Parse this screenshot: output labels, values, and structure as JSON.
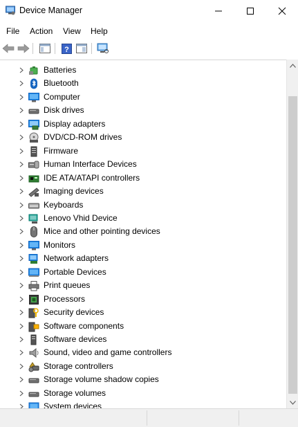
{
  "window": {
    "title": "Device Manager"
  },
  "menu": {
    "items": [
      "File",
      "Action",
      "View",
      "Help"
    ]
  },
  "tree": {
    "items": [
      {
        "label": "Batteries",
        "icon": "battery-icon"
      },
      {
        "label": "Bluetooth",
        "icon": "bluetooth-icon"
      },
      {
        "label": "Computer",
        "icon": "computer-icon"
      },
      {
        "label": "Disk drives",
        "icon": "disk-drive-icon"
      },
      {
        "label": "Display adapters",
        "icon": "display-adapter-icon"
      },
      {
        "label": "DVD/CD-ROM drives",
        "icon": "dvd-drive-icon"
      },
      {
        "label": "Firmware",
        "icon": "firmware-icon"
      },
      {
        "label": "Human Interface Devices",
        "icon": "hid-icon"
      },
      {
        "label": "IDE ATA/ATAPI controllers",
        "icon": "ide-controller-icon"
      },
      {
        "label": "Imaging devices",
        "icon": "imaging-device-icon"
      },
      {
        "label": "Keyboards",
        "icon": "keyboard-icon"
      },
      {
        "label": "Lenovo Vhid Device",
        "icon": "lenovo-device-icon"
      },
      {
        "label": "Mice and other pointing devices",
        "icon": "mouse-icon"
      },
      {
        "label": "Monitors",
        "icon": "monitor-icon"
      },
      {
        "label": "Network adapters",
        "icon": "network-adapter-icon"
      },
      {
        "label": "Portable Devices",
        "icon": "portable-device-icon"
      },
      {
        "label": "Print queues",
        "icon": "printer-icon"
      },
      {
        "label": "Processors",
        "icon": "processor-icon"
      },
      {
        "label": "Security devices",
        "icon": "security-device-icon"
      },
      {
        "label": "Software components",
        "icon": "software-component-icon"
      },
      {
        "label": "Software devices",
        "icon": "software-device-icon"
      },
      {
        "label": "Sound, video and game controllers",
        "icon": "speaker-icon"
      },
      {
        "label": "Storage controllers",
        "icon": "storage-controller-icon"
      },
      {
        "label": "Storage volume shadow copies",
        "icon": "shadow-copy-icon"
      },
      {
        "label": "Storage volumes",
        "icon": "storage-volume-icon"
      },
      {
        "label": "System devices",
        "icon": "system-device-icon"
      }
    ]
  },
  "colors": {
    "accent_blue": "#1e88e5",
    "icon_gray": "#5a5a5a",
    "scroll_thumb": "#cdcdcd"
  }
}
